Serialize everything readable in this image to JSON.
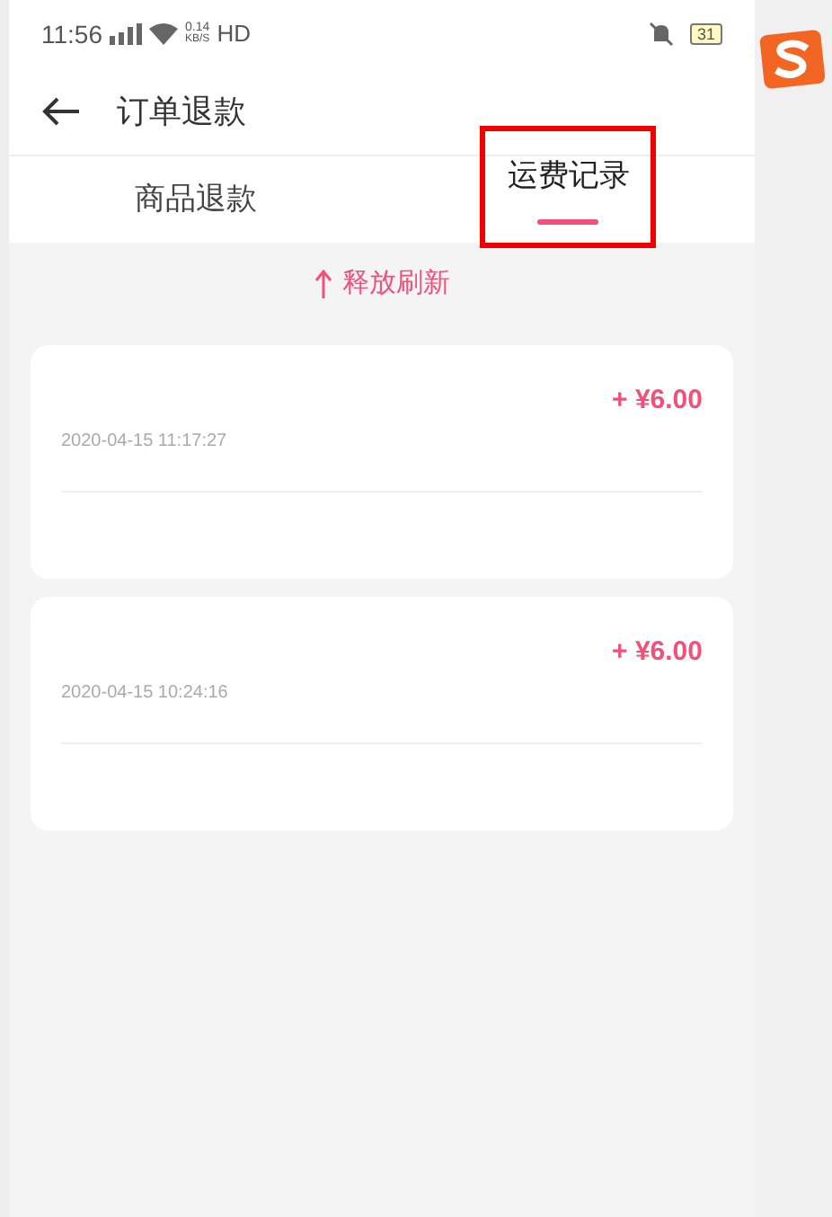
{
  "status_bar": {
    "time": "11:56",
    "speed_value": "0.14",
    "speed_unit": "KB/S",
    "network": "HD",
    "battery": "31"
  },
  "header": {
    "title": "订单退款"
  },
  "tabs": [
    {
      "label": "商品退款",
      "selected": false,
      "highlighted": false
    },
    {
      "label": "运费记录",
      "selected": true,
      "highlighted": true
    }
  ],
  "refresh_hint": "释放刷新",
  "records": [
    {
      "amount": "+ ¥6.00",
      "time": "2020-04-15 11:17:27"
    },
    {
      "amount": "+ ¥6.00",
      "time": "2020-04-15 10:24:16"
    }
  ]
}
